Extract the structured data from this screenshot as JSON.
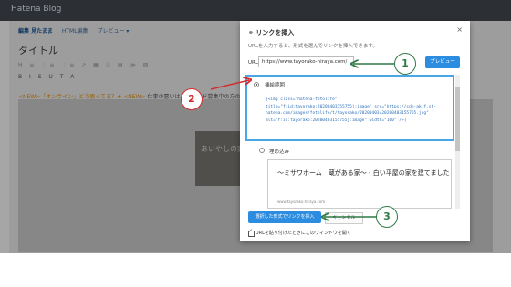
{
  "app": {
    "logo": "Hatena Blog"
  },
  "editor": {
    "tabs": [
      {
        "label": "編集 見たまま"
      },
      {
        "label": "HTML編集"
      },
      {
        "label": "プレビュー ▾"
      }
    ],
    "title_placeholder": "タイトル",
    "toolbar_row1": "H  ≡  ⋮≡  ⋮≡  ↗  ▦  ⚇  ▤  ≫  ▨",
    "toolbar_row2": "B  I  S  U  T  A",
    "note": {
      "prefix": "<NEW>「オンライン」どう思ってる？★",
      "middle": "<NEW>",
      "suffix": "仕事の悪いはエピソード募集中の方の題☆"
    },
    "image_caption": "あいやしの家"
  },
  "dialog": {
    "title": "リンクを挿入",
    "close": "×",
    "description": "URLを入力すると、形式を選んでリンクを挿入できます。",
    "url_label": "URL",
    "url_value": "https://www.tayorako-hiraya.com/",
    "preview_button": "プレビュー",
    "options": [
      {
        "label": "挿絵範囲",
        "code_lines": [
          "[<img class=\"hatena-fotolife\"",
          "title=\"f:id:tayorako:20200403155755j:image\" src=\"https://cdn-ak.f.st-",
          "hatena.com/images/fotolife/t/tayorako/20200403/20200403155755.jpg\"",
          "alt=\"f:id:tayorako:20200403155755j:image\" width=\"160\" />]"
        ]
      },
      {
        "label": "埋め込み",
        "embed_title": "〜ミサワホーム　蔵がある家〜・白い平屋の家を建てました",
        "embed_source": "www.tayorako-hiraya.com"
      }
    ],
    "insert_button": "選択した形式でリンクを挿入",
    "cancel_button": "キャンセル",
    "checkbox_label": "URLを貼り付けたときにこのウィンドウを開く",
    "checkbox_checked": true
  },
  "annotations": [
    {
      "number": "1",
      "color": "#2f7a45"
    },
    {
      "number": "2",
      "color": "#d32c2c"
    },
    {
      "number": "3",
      "color": "#2f7a45"
    }
  ]
}
